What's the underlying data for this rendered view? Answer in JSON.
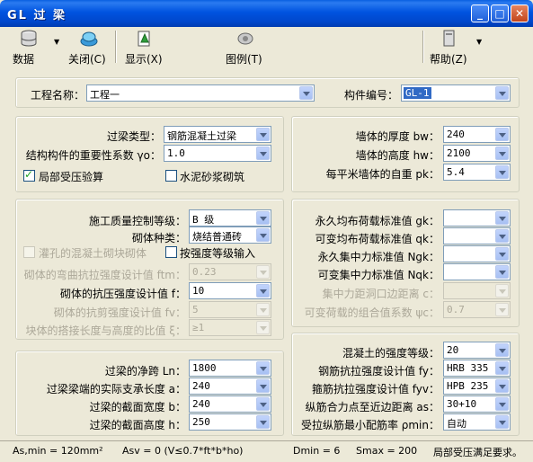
{
  "window": {
    "title": "GL 过 梁"
  },
  "toolbar": {
    "data": "数据",
    "close": "关闭(C)",
    "display": "显示(X)",
    "legend": "图例(T)",
    "help": "帮助(Z)"
  },
  "top": {
    "project_label": "工程名称：",
    "project_value": "工程一",
    "member_label": "构件编号：",
    "member_value": "GL-1"
  },
  "left1": {
    "lintel_type_label": "过梁类型：",
    "lintel_type_value": "钢筋混凝土过梁",
    "importance_label": "结构构件的重要性系数 γo：",
    "importance_value": "1.0",
    "local_press_label": "局部受压验算",
    "local_press_checked": true,
    "cement_mortar_label": "水泥砂浆砌筑",
    "cement_mortar_checked": false
  },
  "right1": {
    "wall_thick_label": "墙体的厚度 bw：",
    "wall_thick_value": "240",
    "wall_height_label": "墙体的高度 hw：",
    "wall_height_value": "2100",
    "wall_weight_label": "每平米墙体的自重 pk：",
    "wall_weight_value": "5.4"
  },
  "left2": {
    "quality_label": "施工质量控制等级：",
    "quality_value": "B 级",
    "masonry_label": "砌体种类：",
    "masonry_value": "烧结普通砖",
    "grout_label": "灌孔的混凝土砌块砌体",
    "byclass_label": "按强度等级输入",
    "ftm_label": "砌体的弯曲抗拉强度设计值 ftm：",
    "ftm_value": "0.23",
    "f_label": "砌体的抗压强度设计值 f：",
    "f_value": "10",
    "fv_label": "砌体的抗剪强度设计值 fv：",
    "fv_value": "5",
    "ratio_label": "块体的搭接长度与高度的比值 ξ：",
    "ratio_value": "≥1"
  },
  "right2": {
    "gk_label": "永久均布荷载标准值 gk：",
    "gk_value": "",
    "qk_label": "可变均布荷载标准值 qk：",
    "qk_value": "",
    "Ngk_label": "永久集中力标准值 Ngk：",
    "Ngk_value": "",
    "Nqk_label": "可变集中力标准值 Nqk：",
    "Nqk_value": "",
    "c_label": "集中力距洞口边距离 c：",
    "c_value": "",
    "psi_label": "可变荷载的组合值系数 ψc：",
    "psi_value": "0.7"
  },
  "left3": {
    "ln_label": "过梁的净跨 Ln：",
    "ln_value": "1800",
    "a_label": "过梁梁端的实际支承长度 a：",
    "a_value": "240",
    "b_label": "过梁的截面宽度 b：",
    "b_value": "240",
    "h_label": "过梁的截面高度 h：",
    "h_value": "250"
  },
  "right3": {
    "concrete_label": "混凝土的强度等级：",
    "concrete_value": "20",
    "fy_label": "钢筋抗拉强度设计值 fy：",
    "fy_value": "HRB 335",
    "fyv_label": "箍筋抗拉强度设计值 fyv：",
    "fyv_value": "HPB 235",
    "as_label": "纵筋合力点至近边距离 as：",
    "as_value": "30+10",
    "pmin_label": "受拉纵筋最小配筋率 ρmin：",
    "pmin_value": "自动"
  },
  "status": {
    "as_min": "As,min = 120mm²",
    "asv": "Asv = 0 (V≤0.7*ft*b*ho)",
    "dmin": "Dmin = 6",
    "smax": "Smax = 200",
    "msg": "局部受压满足要求。"
  }
}
